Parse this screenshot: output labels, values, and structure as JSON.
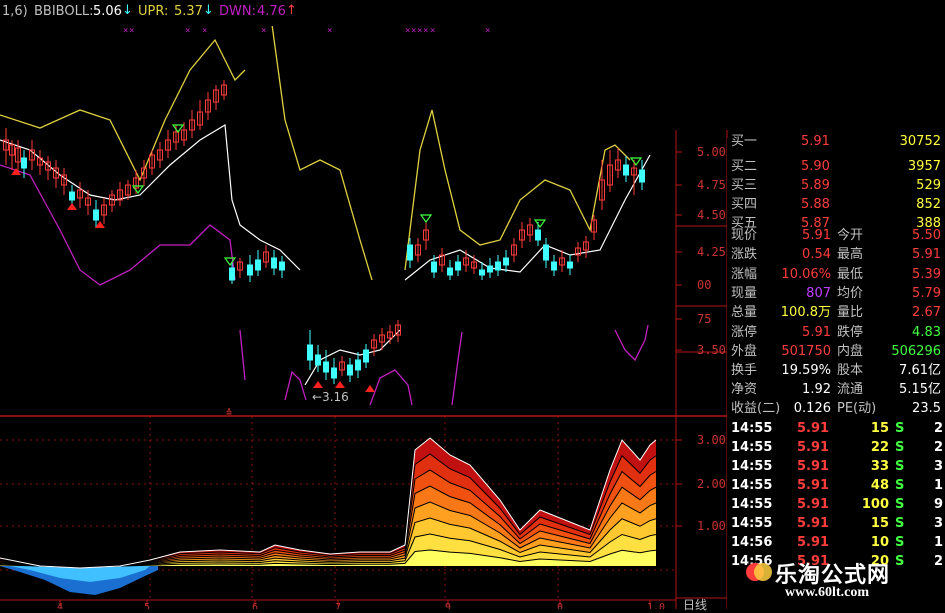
{
  "indicator": {
    "name_partial": "1,6)",
    "name": "BBIBOLL:",
    "bbiboll_value": "5.06",
    "upr_label": "UPR:",
    "upr_value": "5.37",
    "dwn_label": "DWN:",
    "dwn_value": "4.76",
    "arrow_down": "↓",
    "arrow_up": "↑"
  },
  "axis": {
    "price_ticks": [
      "5.00",
      "4.75",
      "4.50",
      "4.25",
      "00",
      "75",
      "3.50"
    ],
    "lower_ticks": [
      "3.00",
      "2.00",
      "1.00"
    ],
    "low_annotation": "←3.16",
    "date_ticks": [
      "4",
      "5",
      "6",
      "7",
      "9",
      "0",
      "1.0"
    ],
    "corner_label": "日线"
  },
  "orderbook": {
    "bids": [
      {
        "label": "买一",
        "price": "5.91",
        "vol": "30752",
        "partial": true
      },
      {
        "label": "买二",
        "price": "5.90",
        "vol": "3957"
      },
      {
        "label": "买三",
        "price": "5.89",
        "vol": "529"
      },
      {
        "label": "买四",
        "price": "5.88",
        "vol": "852"
      },
      {
        "label": "买五",
        "price": "5.87",
        "vol": "388"
      }
    ]
  },
  "quote": {
    "rows": [
      {
        "l1": "现价",
        "v1": "5.91",
        "c1": "#ff3c3c",
        "l2": "今开",
        "v2": "5.50",
        "c2": "#ff3c3c"
      },
      {
        "l1": "涨跌",
        "v1": "0.54",
        "c1": "#ff3c3c",
        "l2": "最高",
        "v2": "5.91",
        "c2": "#ff3c3c"
      },
      {
        "l1": "涨幅",
        "v1": "10.06%",
        "c1": "#ff3c3c",
        "l2": "最低",
        "v2": "5.39",
        "c2": "#ff3c3c"
      },
      {
        "l1": "现量",
        "v1": "807",
        "c1": "#c040ff",
        "l2": "均价",
        "v2": "5.79",
        "c2": "#ff3c3c"
      },
      {
        "l1": "总量",
        "v1": "100.8万",
        "c1": "#ffff40",
        "l2": "量比",
        "v2": "2.67",
        "c2": "#ff3c3c"
      },
      {
        "l1": "涨停",
        "v1": "5.91",
        "c1": "#ff3c3c",
        "l2": "跌停",
        "v2": "4.83",
        "c2": "#40ff40"
      },
      {
        "l1": "外盘",
        "v1": "501750",
        "c1": "#ff3c3c",
        "l2": "内盘",
        "v2": "506296",
        "c2": "#40ff40"
      }
    ],
    "fundamentals": [
      {
        "l1": "换手",
        "v1": "19.59%",
        "l2": "股本",
        "v2": "7.61亿"
      },
      {
        "l1": "净资",
        "v1": "1.92",
        "l2": "流通",
        "v2": "5.15亿"
      },
      {
        "l1": "收益(二)",
        "v1": "0.126",
        "l2": "PE(动)",
        "v2": "23.5"
      }
    ]
  },
  "ticks": [
    {
      "time": "14:55",
      "price": "5.91",
      "vol": "15",
      "side": "S",
      "n": "2"
    },
    {
      "time": "14:55",
      "price": "5.91",
      "vol": "22",
      "side": "S",
      "n": "2"
    },
    {
      "time": "14:55",
      "price": "5.91",
      "vol": "33",
      "side": "S",
      "n": "3"
    },
    {
      "time": "14:55",
      "price": "5.91",
      "vol": "48",
      "side": "S",
      "n": "1"
    },
    {
      "time": "14:55",
      "price": "5.91",
      "vol": "100",
      "side": "S",
      "n": "9"
    },
    {
      "time": "14:55",
      "price": "5.91",
      "vol": "15",
      "side": "S",
      "n": "3"
    },
    {
      "time": "14:56",
      "price": "5.91",
      "vol": "10",
      "side": "S",
      "n": "1"
    },
    {
      "time": "14:56",
      "price": "5.91",
      "vol": "20",
      "side": "S",
      "n": "2"
    }
  ],
  "watermark": {
    "site_name": "乐淘公式网",
    "site_url": "www.60lt.com"
  },
  "colors": {
    "up": "#ff3c3c",
    "down": "#40ffff",
    "grid": "#b41414",
    "bbi": "#ffffff",
    "upr": "#e0d040",
    "dwn": "#c020c0",
    "volume_green": "#40ff40",
    "label": "#c0c0c0"
  }
}
